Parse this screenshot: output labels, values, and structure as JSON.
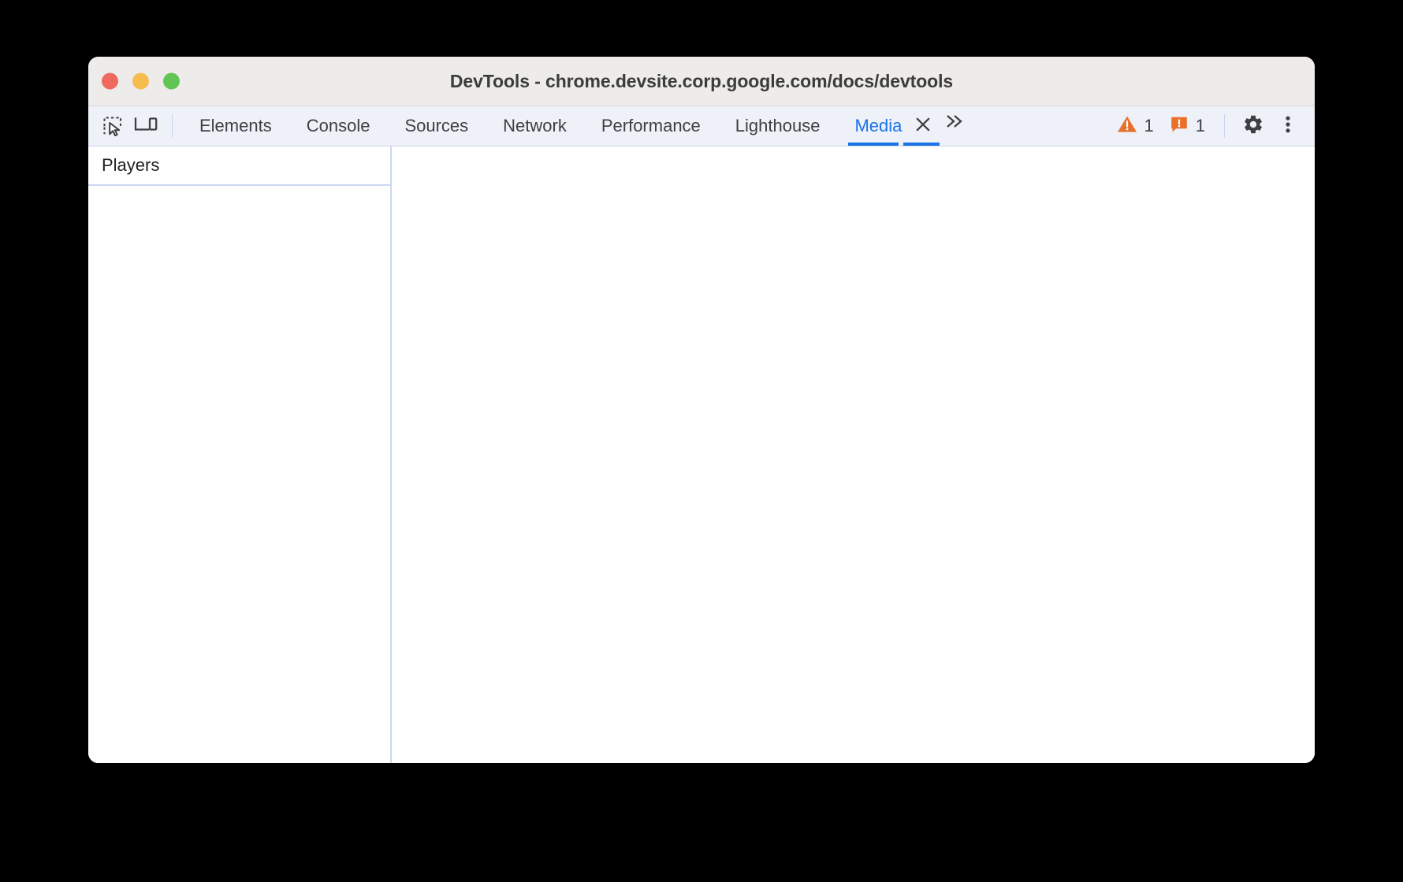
{
  "window": {
    "title": "DevTools - chrome.devsite.corp.google.com/docs/devtools",
    "traffic_lights": [
      {
        "name": "close",
        "color": "#ee6a5f"
      },
      {
        "name": "minimize",
        "color": "#f5bd4f"
      },
      {
        "name": "maximize",
        "color": "#61c555"
      }
    ]
  },
  "toolbar": {
    "inspect_icon": "inspect-element-icon",
    "device_icon": "device-toolbar-icon",
    "tabs": [
      {
        "label": "Elements",
        "active": false
      },
      {
        "label": "Console",
        "active": false
      },
      {
        "label": "Sources",
        "active": false
      },
      {
        "label": "Network",
        "active": false
      },
      {
        "label": "Performance",
        "active": false
      },
      {
        "label": "Lighthouse",
        "active": false
      },
      {
        "label": "Media",
        "active": true
      }
    ],
    "close_tab_icon": "close-icon",
    "more_tabs_icon": "chevron-double-right-icon",
    "warnings": {
      "icon": "warning-triangle-icon",
      "count": "1",
      "color": "#e8702a"
    },
    "issues": {
      "icon": "issues-icon",
      "count": "1",
      "color": "#e8702a"
    },
    "settings_icon": "gear-icon",
    "more_options_icon": "kebab-menu-icon",
    "accent_color": "#1a73e8"
  },
  "panel": {
    "sidebar": {
      "header": "Players",
      "items": []
    },
    "main": {
      "content": ""
    }
  }
}
